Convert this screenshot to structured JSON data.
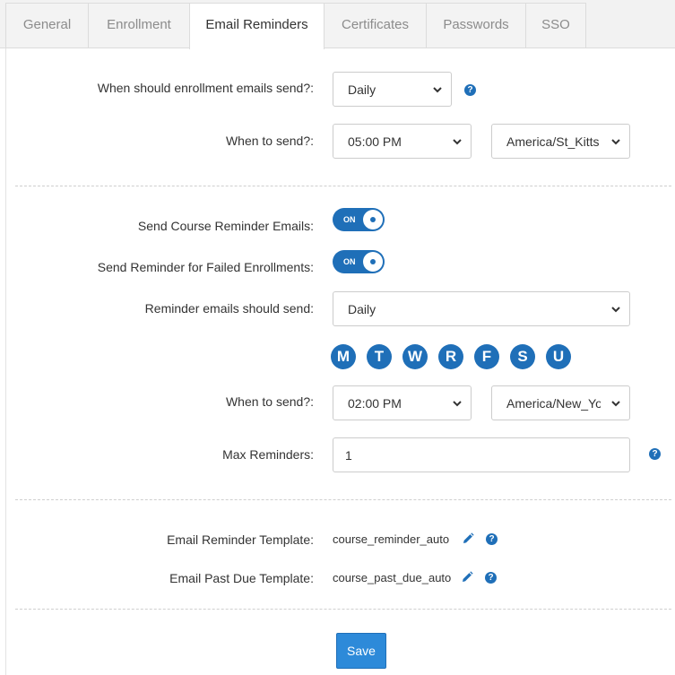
{
  "tabs": [
    {
      "label": "General"
    },
    {
      "label": "Enrollment"
    },
    {
      "label": "Email Reminders"
    },
    {
      "label": "Certificates"
    },
    {
      "label": "Passwords"
    },
    {
      "label": "SSO"
    }
  ],
  "enrollment": {
    "frequency_label": "When should enrollment emails send?:",
    "frequency_value": "Daily",
    "time_label": "When to send?:",
    "time_value": "05:00 PM",
    "timezone_value": "America/St_Kitts"
  },
  "reminders": {
    "course_reminder_label": "Send Course Reminder Emails:",
    "course_reminder_toggle": "ON",
    "failed_label": "Send Reminder for Failed Enrollments:",
    "failed_toggle": "ON",
    "frequency_label": "Reminder emails should send:",
    "frequency_value": "Daily",
    "days": [
      "M",
      "T",
      "W",
      "R",
      "F",
      "S",
      "U"
    ],
    "time_label": "When to send?:",
    "time_value": "02:00 PM",
    "timezone_value": "America/New_York",
    "max_label": "Max Reminders:",
    "max_value": "1"
  },
  "templates": {
    "reminder_label": "Email Reminder Template:",
    "reminder_value": "course_reminder_auto",
    "past_due_label": "Email Past Due Template:",
    "past_due_value": "course_past_due_auto"
  },
  "help_glyph": "?",
  "save_label": "Save",
  "colors": {
    "accent": "#1f6fb8",
    "save_button": "#2d8ad9"
  }
}
